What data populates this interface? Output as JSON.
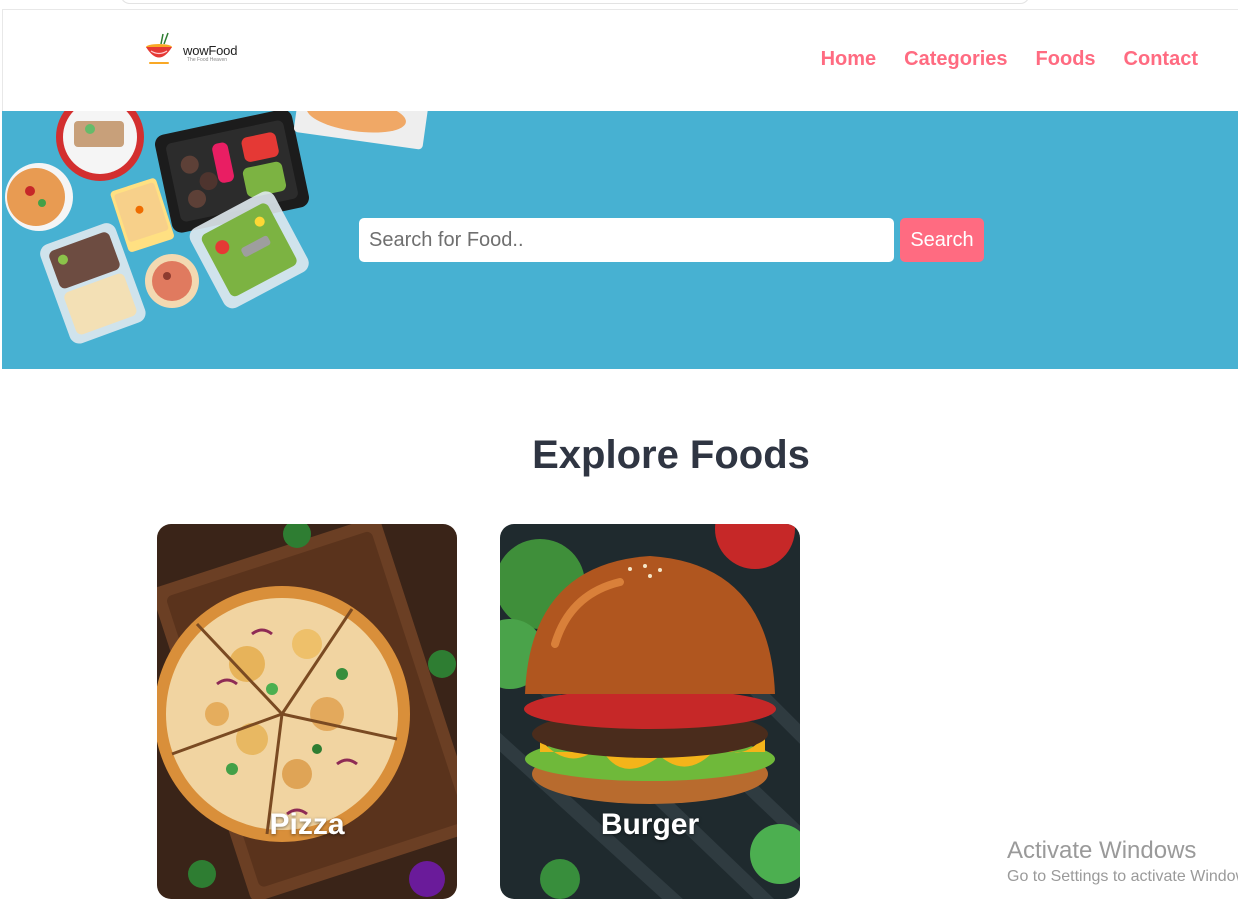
{
  "brand": {
    "name": "wowFood",
    "tagline": "The Food Heaven"
  },
  "nav": {
    "items": [
      {
        "label": "Home"
      },
      {
        "label": "Categories"
      },
      {
        "label": "Foods"
      },
      {
        "label": "Contact"
      }
    ]
  },
  "search": {
    "placeholder": "Search for Food..",
    "button_label": "Search"
  },
  "explore": {
    "title": "Explore Foods",
    "categories": [
      {
        "label": "Pizza"
      },
      {
        "label": "Burger"
      }
    ]
  },
  "watermark": {
    "title": "Activate Windows",
    "subtitle": "Go to Settings to activate Windows."
  },
  "colors": {
    "accent": "#ff6b81",
    "hero_bg": "#47b1d2",
    "heading": "#2f3542"
  }
}
